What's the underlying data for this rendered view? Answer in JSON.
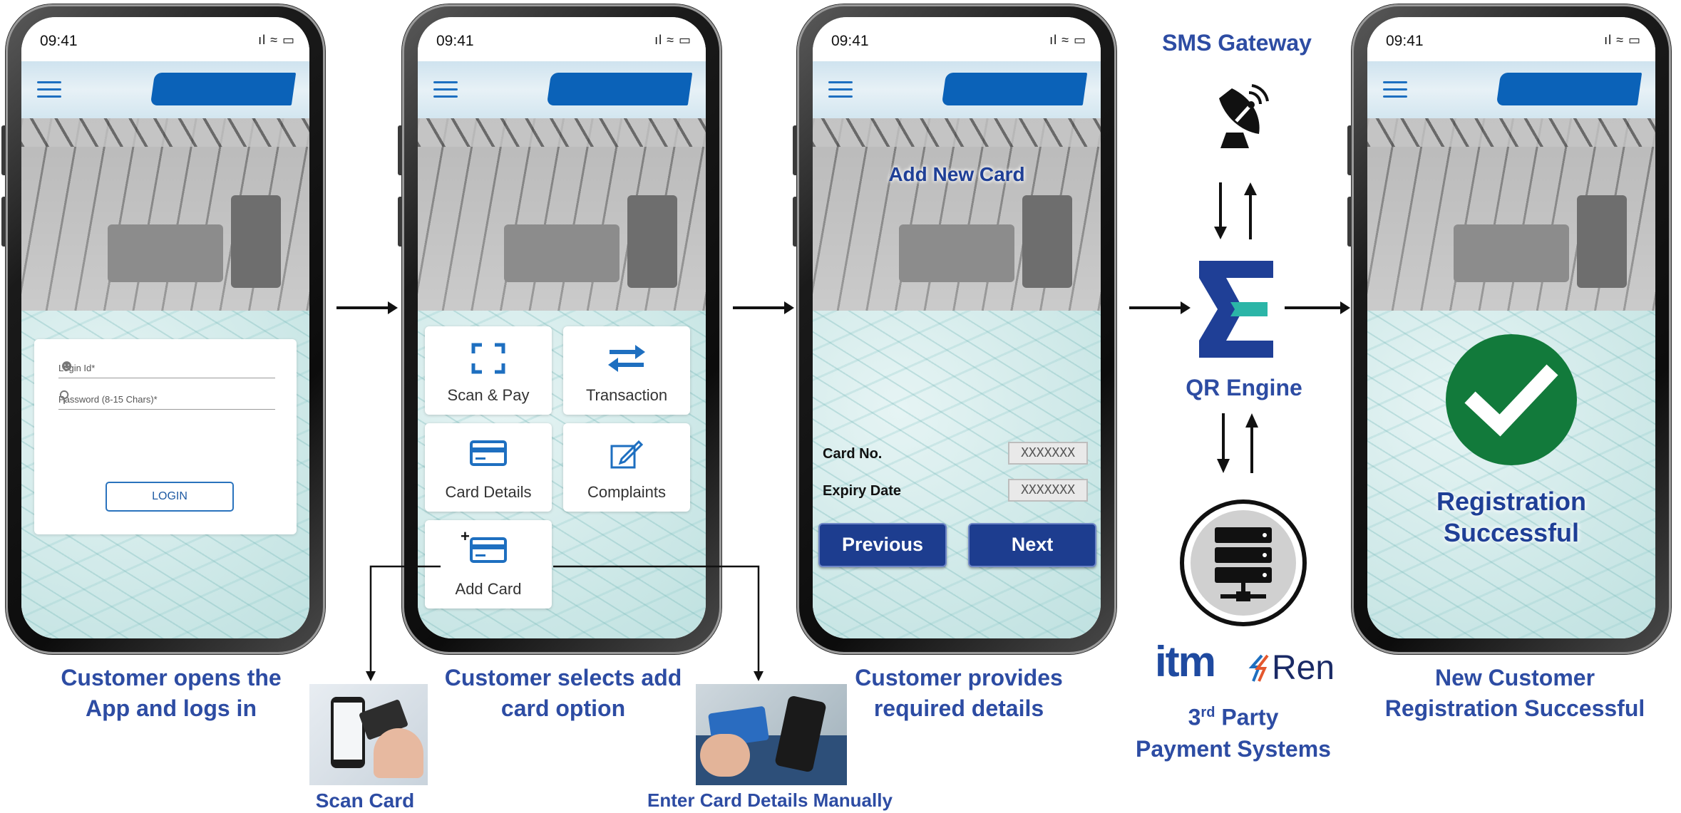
{
  "phones": [
    {
      "time": "09:41",
      "sys": "ıl ≈ ▭"
    },
    {
      "time": "09:41",
      "sys": "ıl ≈ ▭"
    },
    {
      "time": "09:41",
      "sys": "ıl ≈ ▭"
    },
    {
      "time": "09:41",
      "sys": "ıl ≈ ▭"
    }
  ],
  "login": {
    "login_id_placeholder": "Login Id*",
    "password_placeholder": "Password (8-15 Chars)*",
    "login_button": "LOGIN"
  },
  "menu_tiles": [
    {
      "label": "Scan & Pay",
      "icon": "scan-icon"
    },
    {
      "label": "Transaction",
      "icon": "swap-arrows-icon"
    },
    {
      "label": "Card Details",
      "icon": "card-icon"
    },
    {
      "label": "Complaints",
      "icon": "edit-icon"
    },
    {
      "label": "Add Card",
      "icon": "add-card-icon",
      "plus": "+"
    }
  ],
  "add_card_form": {
    "title": "Add New Card",
    "card_no_label": "Card No.",
    "card_no_value": "XXXXXXX",
    "expiry_label": "Expiry Date",
    "expiry_value": "XXXXXXX",
    "previous_button": "Previous",
    "next_button": "Next"
  },
  "success_screen": {
    "line1": "Registration",
    "line2": "Successful"
  },
  "captions": {
    "step1_line1": "Customer opens the",
    "step1_line2": "App and logs in",
    "step2_line1": "Customer selects add",
    "step2_line2": "card option",
    "step3_line1": "Customer provides",
    "step3_line2": "required details",
    "step4_line1": "New Customer",
    "step4_line2": "Registration Successful",
    "scan_card": "Scan Card",
    "enter_manually": "Enter Card Details Manually"
  },
  "middle_column": {
    "sms_gateway": "SMS Gateway",
    "qr_engine": "QR Engine",
    "third_party_sup": "rd",
    "third_party_num": "3",
    "third_party_line1": " Party",
    "third_party_line2": "Payment Systems",
    "logo_itm": "itm",
    "logo_ren": "Ren"
  },
  "colors": {
    "caption_blue": "#2d4ca3",
    "button_navy": "#1d3d8f",
    "brand_blue": "#0b62b8",
    "success_green": "#127a3b",
    "qr_accent": "#2bb5a7"
  }
}
